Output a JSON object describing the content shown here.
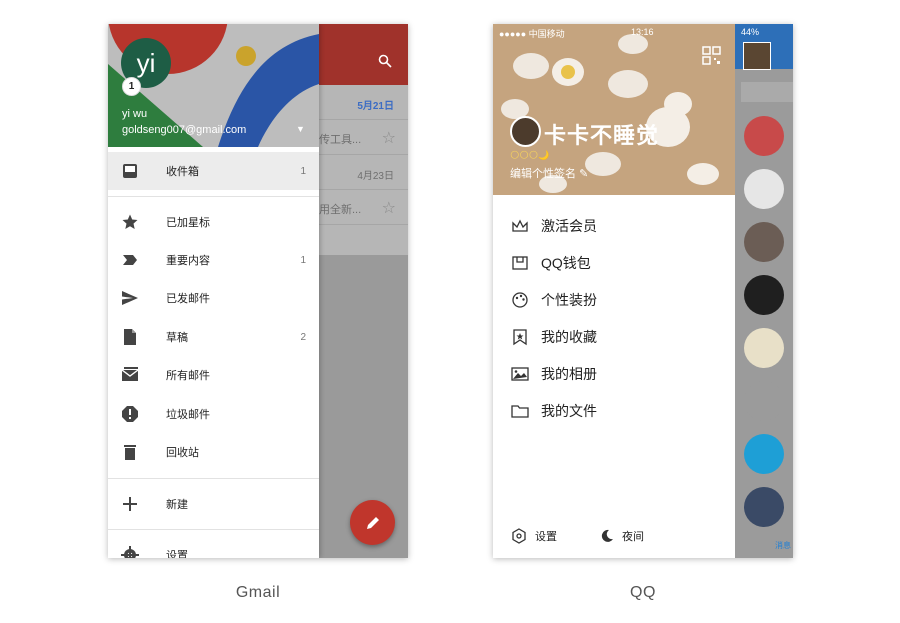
{
  "gmail": {
    "caption": "Gmail",
    "account": {
      "avatar_letter": "yi",
      "badge": "1",
      "name": "yi wu",
      "email": "goldseng007@gmail.com"
    },
    "behind": {
      "date_bold": "5月21日",
      "row1_snippet": "传工具...",
      "row2_date": "4月23日",
      "row3_snippet": "用全新..."
    },
    "menu": [
      {
        "label": "收件箱",
        "count": "1",
        "icon": "inbox-icon"
      },
      {
        "label": "已加星标",
        "count": "",
        "icon": "star-icon"
      },
      {
        "label": "重要内容",
        "count": "1",
        "icon": "important-icon"
      },
      {
        "label": "已发邮件",
        "count": "",
        "icon": "send-icon"
      },
      {
        "label": "草稿",
        "count": "2",
        "icon": "draft-icon"
      },
      {
        "label": "所有邮件",
        "count": "",
        "icon": "all-mail-icon"
      },
      {
        "label": "垃圾邮件",
        "count": "",
        "icon": "spam-icon"
      },
      {
        "label": "回收站",
        "count": "",
        "icon": "trash-icon"
      },
      {
        "label": "新建",
        "count": "",
        "icon": "plus-icon"
      },
      {
        "label": "设置",
        "count": "",
        "icon": "gear-icon"
      }
    ],
    "colors": {
      "accent_red": "#c0362c",
      "header_green": "#1e5d45"
    }
  },
  "qq": {
    "caption": "QQ",
    "status": {
      "signal": "●●●●● 中国移动",
      "time": "13:16",
      "battery": "44%"
    },
    "profile": {
      "nickname": "卡卡不睡觉",
      "signature": "编辑个性签名",
      "level_crowns": "🌕🌕🌕🌙"
    },
    "menu": [
      {
        "label": "激活会员",
        "icon": "crown-icon"
      },
      {
        "label": "QQ钱包",
        "icon": "wallet-icon"
      },
      {
        "label": "个性装扮",
        "icon": "palette-icon"
      },
      {
        "label": "我的收藏",
        "icon": "bookmark-star-icon"
      },
      {
        "label": "我的相册",
        "icon": "photo-icon"
      },
      {
        "label": "我的文件",
        "icon": "folder-icon"
      }
    ],
    "footer": {
      "settings": "设置",
      "night": "夜间"
    },
    "rail_label": "消息",
    "colors": {
      "header_bg": "#c5a47f"
    }
  }
}
